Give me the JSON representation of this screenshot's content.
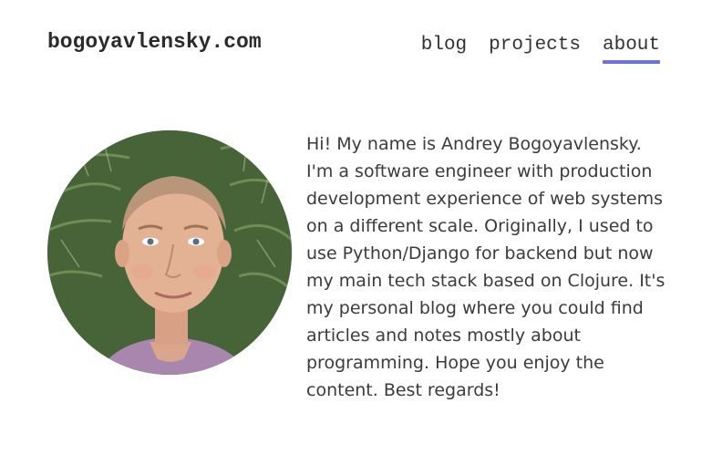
{
  "site": {
    "title": "bogoyavlensky.com"
  },
  "nav": {
    "items": [
      {
        "label": "blog",
        "active": false
      },
      {
        "label": "projects",
        "active": false
      },
      {
        "label": "about",
        "active": true
      }
    ],
    "active_color": "#6b73d6"
  },
  "about": {
    "photo_icon": "portrait-photo",
    "bio": "Hi! My name is Andrey Bogoyavlensky. I'm a software engineer with production development experience of web systems on a different scale. Originally, I used to use Python/Django for backend but now my main tech stack based on Clojure. It's my personal blog where you could find articles and notes mostly about programming. Hope you enjoy the content. Best regards!"
  }
}
